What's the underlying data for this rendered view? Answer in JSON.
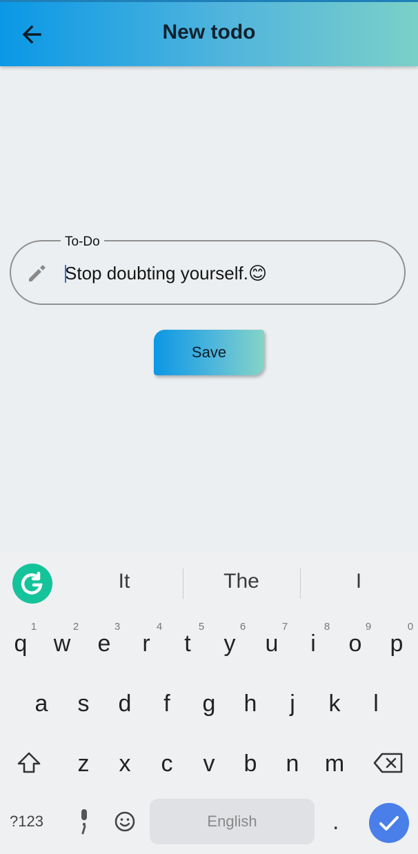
{
  "appbar": {
    "title": "New todo",
    "back_icon": "arrow-left-icon"
  },
  "form": {
    "label": "To-Do",
    "value": "Stop doubting yourself.😊",
    "prefix_icon": "pencil-icon",
    "save_label": "Save"
  },
  "keyboard": {
    "suggestions": [
      "It",
      "The",
      "I"
    ],
    "hints": [
      "1",
      "2",
      "3",
      "4",
      "5",
      "6",
      "7",
      "8",
      "9",
      "0"
    ],
    "row1": [
      "q",
      "w",
      "e",
      "r",
      "t",
      "y",
      "u",
      "i",
      "o",
      "p"
    ],
    "row2": [
      "a",
      "s",
      "d",
      "f",
      "g",
      "h",
      "j",
      "k",
      "l"
    ],
    "row3": [
      "z",
      "x",
      "c",
      "v",
      "b",
      "n",
      "m"
    ],
    "symbols_label": "?123",
    "space_label": "English",
    "period_label": "."
  },
  "colors": {
    "appbar_start": "#0a98e6",
    "appbar_end": "#7ad0c8",
    "background": "#eceff1",
    "enter_key": "#4a7ee8",
    "grammarly": "#15c39a"
  }
}
